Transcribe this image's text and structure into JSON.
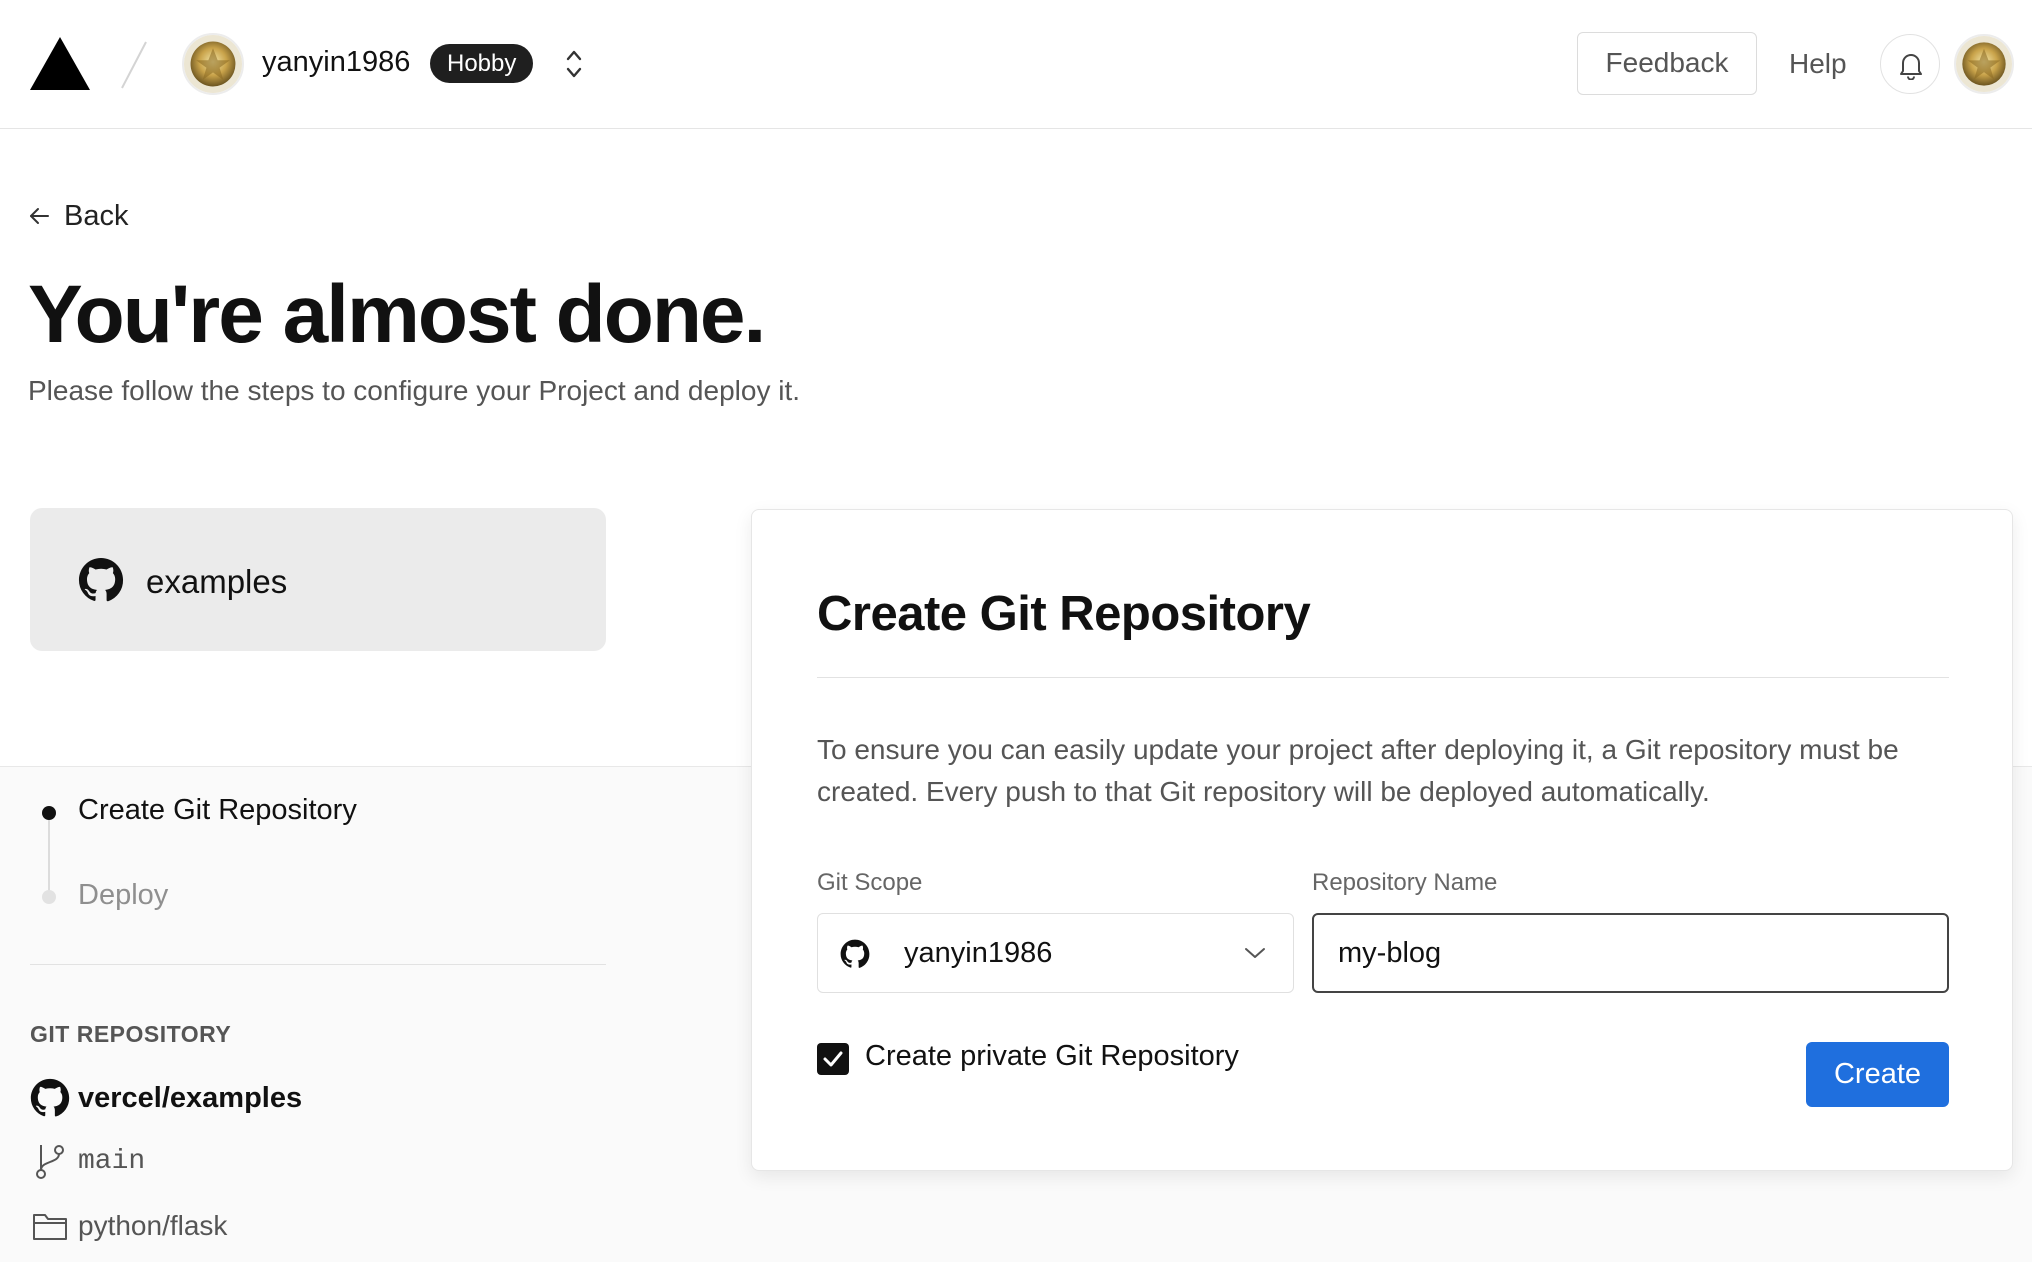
{
  "header": {
    "team_name": "yanyin1986",
    "plan_badge": "Hobby",
    "feedback_label": "Feedback",
    "help_label": "Help"
  },
  "page": {
    "back_label": "Back",
    "title": "You're almost done.",
    "subtitle": "Please follow the steps to configure your Project and deploy it."
  },
  "template": {
    "name": "examples"
  },
  "steps": [
    {
      "label": "Create Git Repository",
      "state": "active"
    },
    {
      "label": "Deploy",
      "state": "inactive"
    }
  ],
  "git_repository": {
    "heading": "GIT REPOSITORY",
    "repo": "vercel/examples",
    "branch": "main",
    "directory": "python/flask"
  },
  "create_panel": {
    "title": "Create Git Repository",
    "description": "To ensure you can easily update your project after deploying it, a Git repository must be created. Every push to that Git repository will be deployed automatically.",
    "scope_label": "Git Scope",
    "scope_value": "yanyin1986",
    "name_label": "Repository Name",
    "name_value": "my-blog",
    "private_label": "Create private Git Repository",
    "private_checked": true,
    "create_label": "Create"
  },
  "colors": {
    "accent": "#1f6fde",
    "badge_bg": "#1f1f1f",
    "band_bg": "#fafafa",
    "card_bg": "#ebebeb"
  }
}
